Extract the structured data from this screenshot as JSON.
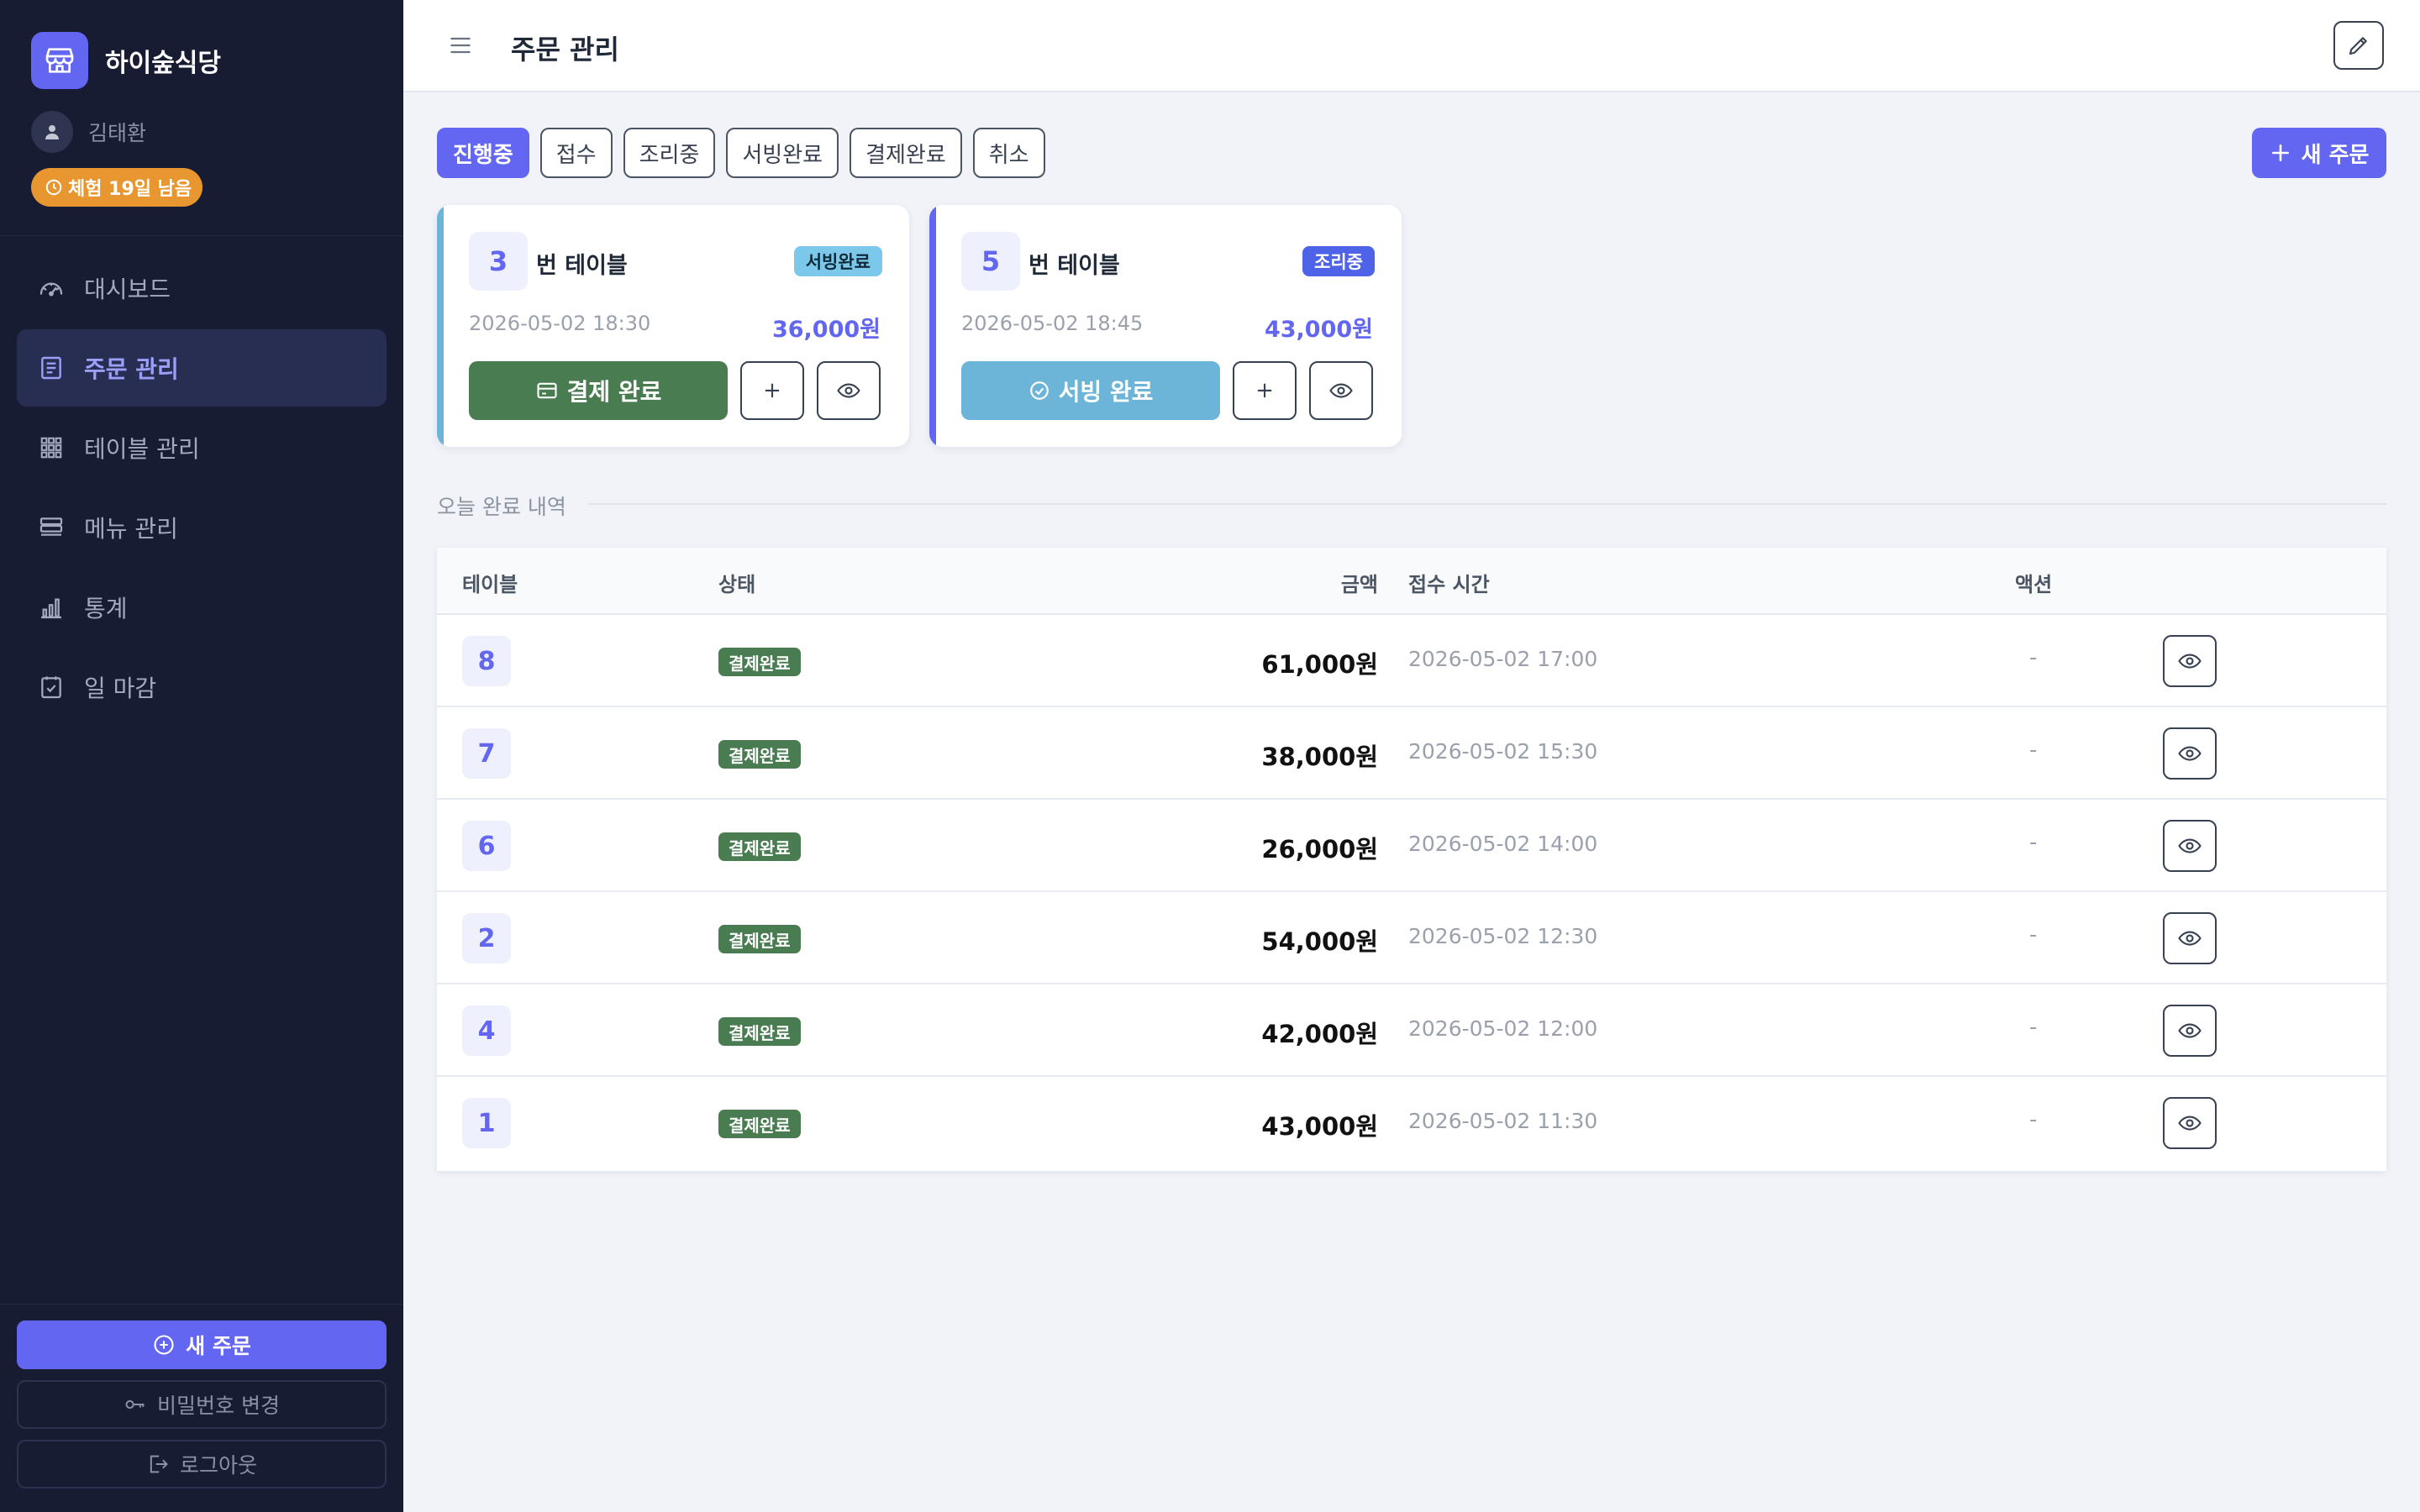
{
  "sidebar": {
    "brand_name": "하이숲식당",
    "user_name": "김태환",
    "trial_badge": "체험 19일 남음",
    "nav": [
      {
        "label": "대시보드",
        "icon": "gauge-icon"
      },
      {
        "label": "주문 관리",
        "icon": "receipt-icon",
        "active": true
      },
      {
        "label": "테이블 관리",
        "icon": "grid-icon"
      },
      {
        "label": "메뉴 관리",
        "icon": "menu-list-icon"
      },
      {
        "label": "통계",
        "icon": "bar-chart-icon"
      },
      {
        "label": "일 마감",
        "icon": "calendar-check-icon"
      }
    ],
    "new_order": "새 주문",
    "change_password": "비밀번호 변경",
    "logout": "로그아웃"
  },
  "header": {
    "title": "주문 관리"
  },
  "filters": {
    "tabs": [
      "진행중",
      "접수",
      "조리중",
      "서빙완료",
      "결제완료",
      "취소"
    ],
    "active": "진행중",
    "new_order": "새 주문"
  },
  "orders": [
    {
      "table": "3",
      "table_suffix": "번 테이블",
      "status": "서빙완료",
      "time": "2026-05-02 18:30",
      "amount": "36,000원",
      "action": "결제 완료",
      "plus": "+"
    },
    {
      "table": "5",
      "table_suffix": "번 테이블",
      "status": "조리중",
      "time": "2026-05-02 18:45",
      "amount": "43,000원",
      "action": "서빙 완료",
      "plus": "+"
    }
  ],
  "history": {
    "title": "오늘 완료 내역",
    "columns": {
      "table": "테이블",
      "status": "상태",
      "amount": "금액",
      "time": "접수 시간",
      "action": "액션"
    },
    "rows": [
      {
        "table": "8",
        "status": "결제완료",
        "amount": "61,000원",
        "time": "2026-05-02 17:00",
        "action": "-"
      },
      {
        "table": "7",
        "status": "결제완료",
        "amount": "38,000원",
        "time": "2026-05-02 15:30",
        "action": "-"
      },
      {
        "table": "6",
        "status": "결제완료",
        "amount": "26,000원",
        "time": "2026-05-02 14:00",
        "action": "-"
      },
      {
        "table": "2",
        "status": "결제완료",
        "amount": "54,000원",
        "time": "2026-05-02 12:30",
        "action": "-"
      },
      {
        "table": "4",
        "status": "결제완료",
        "amount": "42,000원",
        "time": "2026-05-02 12:00",
        "action": "-"
      },
      {
        "table": "1",
        "status": "결제완료",
        "amount": "43,000원",
        "time": "2026-05-02 11:30",
        "action": "-"
      }
    ]
  },
  "colors": {
    "accent": "#6366f1",
    "sidebar_bg": "#181c32",
    "pay_button": "#4a7c52",
    "serve_button": "#6cb4d8",
    "status_serving_done": "#7cc8ea",
    "status_cooking": "#4f63e8",
    "status_paid": "#4a7c52",
    "trial_badge": "#e8962f"
  }
}
